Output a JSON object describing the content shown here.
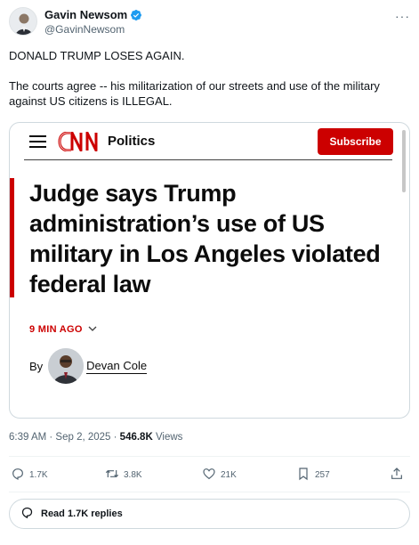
{
  "author": {
    "name": "Gavin Newsom",
    "handle": "@GavinNewsom",
    "verified": true
  },
  "tweet": {
    "line1": "DONALD TRUMP LOSES AGAIN.",
    "line2": "The courts agree -- his militarization of our streets and use of the military against US citizens is ILLEGAL."
  },
  "card": {
    "logo": "CNN",
    "section": "Politics",
    "subscribe_label": "Subscribe",
    "headline": "Judge says Trump administration’s use of US military in Los Angeles violated federal law",
    "timestamp": "9 MIN AGO",
    "byline_prefix": "By",
    "byline_author": "Devan Cole",
    "brand_color": "#cc0000"
  },
  "meta": {
    "time": "6:39 AM · Sep 2, 2025 · ",
    "views_count": "546.8K",
    "views_label": " Views"
  },
  "actions": {
    "replies": "1.7K",
    "reposts": "3.8K",
    "likes": "21K",
    "bookmarks": "257"
  },
  "read_replies_label": "Read 1.7K replies",
  "icons": [
    "verified-badge-icon",
    "more-icon",
    "menu-icon",
    "chevron-down-icon",
    "reply-icon",
    "repost-icon",
    "like-icon",
    "bookmark-icon",
    "share-icon",
    "comment-icon"
  ]
}
